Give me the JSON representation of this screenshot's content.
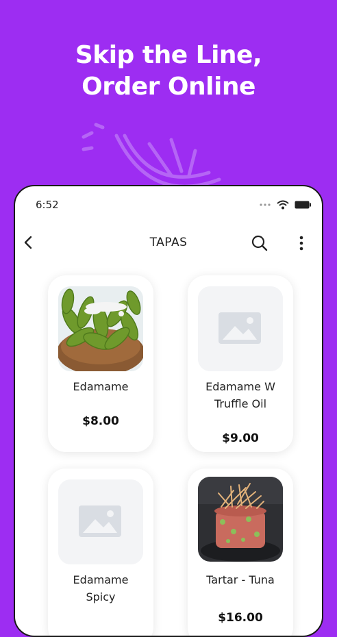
{
  "headline": {
    "line1": "Skip the Line,",
    "line2": "Order Online"
  },
  "status_bar": {
    "time": "6:52"
  },
  "app_bar": {
    "title": "TAPAS"
  },
  "colors": {
    "background": "#9d2df2",
    "card": "#ffffff",
    "placeholder": "#f3f4f6",
    "placeholder_icon": "#d9dde3"
  },
  "products": [
    {
      "name": "Edamame",
      "price": "$8.00",
      "image": "edamame-photo"
    },
    {
      "name": "Edamame W Truffle Oil",
      "price": "$9.00",
      "image": "placeholder-image-icon"
    },
    {
      "name": "Edamame Spicy",
      "price": "",
      "image": "placeholder-image-icon"
    },
    {
      "name": "Tartar - Tuna",
      "price": "$16.00",
      "image": "tuna-tartare-photo"
    }
  ]
}
